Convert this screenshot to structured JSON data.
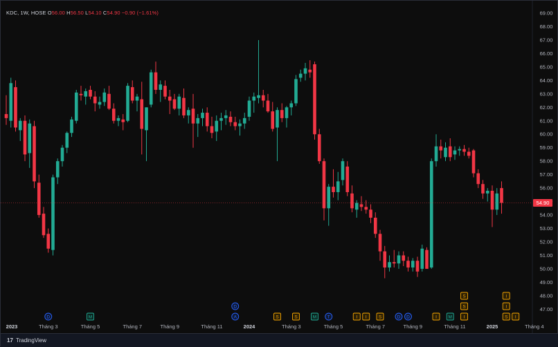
{
  "legend": {
    "symbol": "KDC, 1W, HOSE",
    "open_label": "O",
    "open": "56.00",
    "high_label": "H",
    "high": "56.50",
    "low_label": "L",
    "low": "54.10",
    "close_label": "C",
    "close": "54.90",
    "change": "−0.90 (−1.61%)"
  },
  "branding": {
    "logo": "17",
    "text": "TradingView"
  },
  "colors": {
    "up": "#22ab94",
    "down": "#f23645",
    "background": "#0d0d0d",
    "text": "#b2b5be",
    "price_label": "#f23645"
  },
  "chart_data": {
    "type": "candlestick",
    "title": "",
    "ylim": [
      46.4,
      69.0
    ],
    "y_ticks": [
      "47.00",
      "48.00",
      "49.00",
      "50.00",
      "51.00",
      "52.00",
      "53.00",
      "54.00",
      "55.00",
      "56.00",
      "57.00",
      "58.00",
      "59.00",
      "60.00",
      "61.00",
      "62.00",
      "63.00",
      "64.00",
      "65.00",
      "66.00",
      "67.00",
      "68.00",
      "69.00"
    ],
    "x_tick_labels": [
      "2023",
      "Tháng 3",
      "Tháng 5",
      "Tháng 7",
      "Tháng 9",
      "Tháng 11",
      "2024",
      "Tháng 3",
      "Tháng 5",
      "Tháng 7",
      "Tháng 9",
      "Tháng 11",
      "2025",
      "Tháng 4"
    ],
    "last_price": "54.90",
    "grid": false,
    "candles": [
      {
        "o": 61.5,
        "h": 62.9,
        "l": 60.7,
        "c": 61.2
      },
      {
        "o": 61.0,
        "h": 64.2,
        "l": 60.5,
        "c": 63.8
      },
      {
        "o": 63.5,
        "h": 64.0,
        "l": 60.2,
        "c": 60.5
      },
      {
        "o": 60.3,
        "h": 61.2,
        "l": 59.5,
        "c": 61.0
      },
      {
        "o": 61.0,
        "h": 61.4,
        "l": 58.0,
        "c": 58.5
      },
      {
        "o": 58.6,
        "h": 61.1,
        "l": 57.5,
        "c": 60.8
      },
      {
        "o": 60.6,
        "h": 61.0,
        "l": 56.0,
        "c": 56.5
      },
      {
        "o": 56.4,
        "h": 57.0,
        "l": 53.8,
        "c": 54.0
      },
      {
        "o": 54.1,
        "h": 54.6,
        "l": 52.3,
        "c": 52.5
      },
      {
        "o": 52.6,
        "h": 53.0,
        "l": 51.2,
        "c": 51.5
      },
      {
        "o": 51.4,
        "h": 57.0,
        "l": 51.0,
        "c": 56.8
      },
      {
        "o": 56.8,
        "h": 58.2,
        "l": 56.3,
        "c": 58.0
      },
      {
        "o": 58.0,
        "h": 59.2,
        "l": 57.6,
        "c": 59.0
      },
      {
        "o": 59.0,
        "h": 60.2,
        "l": 58.6,
        "c": 60.1
      },
      {
        "o": 60.1,
        "h": 61.3,
        "l": 59.8,
        "c": 61.1
      },
      {
        "o": 61.0,
        "h": 63.3,
        "l": 60.8,
        "c": 63.1
      },
      {
        "o": 63.0,
        "h": 63.6,
        "l": 62.5,
        "c": 62.9
      },
      {
        "o": 62.8,
        "h": 63.4,
        "l": 62.2,
        "c": 63.2
      },
      {
        "o": 63.3,
        "h": 63.6,
        "l": 62.6,
        "c": 62.8
      },
      {
        "o": 62.8,
        "h": 63.2,
        "l": 61.7,
        "c": 62.3
      },
      {
        "o": 62.2,
        "h": 62.8,
        "l": 61.9,
        "c": 62.4
      },
      {
        "o": 62.4,
        "h": 63.4,
        "l": 62.1,
        "c": 63.1
      },
      {
        "o": 63.0,
        "h": 63.6,
        "l": 61.8,
        "c": 61.9
      },
      {
        "o": 61.9,
        "h": 62.3,
        "l": 60.8,
        "c": 61.0
      },
      {
        "o": 61.0,
        "h": 61.4,
        "l": 60.6,
        "c": 61.2
      },
      {
        "o": 61.1,
        "h": 61.5,
        "l": 60.3,
        "c": 60.9
      },
      {
        "o": 61.0,
        "h": 63.8,
        "l": 60.9,
        "c": 63.6
      },
      {
        "o": 63.5,
        "h": 64.0,
        "l": 62.3,
        "c": 62.5
      },
      {
        "o": 62.5,
        "h": 63.0,
        "l": 61.7,
        "c": 62.8
      },
      {
        "o": 62.6,
        "h": 63.9,
        "l": 58.5,
        "c": 60.4
      },
      {
        "o": 60.3,
        "h": 62.0,
        "l": 58.0,
        "c": 62.0
      },
      {
        "o": 62.2,
        "h": 64.8,
        "l": 62.0,
        "c": 64.6
      },
      {
        "o": 64.6,
        "h": 65.4,
        "l": 63.0,
        "c": 63.3
      },
      {
        "o": 63.3,
        "h": 64.0,
        "l": 62.4,
        "c": 63.7
      },
      {
        "o": 63.6,
        "h": 64.0,
        "l": 62.6,
        "c": 62.8
      },
      {
        "o": 62.8,
        "h": 63.3,
        "l": 61.5,
        "c": 62.5
      },
      {
        "o": 62.6,
        "h": 63.0,
        "l": 61.8,
        "c": 61.9
      },
      {
        "o": 61.9,
        "h": 63.0,
        "l": 61.4,
        "c": 62.8
      },
      {
        "o": 62.7,
        "h": 63.4,
        "l": 61.2,
        "c": 61.4
      },
      {
        "o": 61.4,
        "h": 62.0,
        "l": 60.8,
        "c": 61.8
      },
      {
        "o": 61.9,
        "h": 63.0,
        "l": 59.0,
        "c": 60.8
      },
      {
        "o": 60.8,
        "h": 61.5,
        "l": 59.8,
        "c": 61.2
      },
      {
        "o": 61.2,
        "h": 61.9,
        "l": 60.6,
        "c": 61.6
      },
      {
        "o": 61.6,
        "h": 62.0,
        "l": 60.2,
        "c": 60.6
      },
      {
        "o": 60.6,
        "h": 61.3,
        "l": 59.7,
        "c": 60.1
      },
      {
        "o": 60.2,
        "h": 61.4,
        "l": 59.5,
        "c": 61.0
      },
      {
        "o": 61.0,
        "h": 61.6,
        "l": 60.3,
        "c": 61.2
      },
      {
        "o": 61.2,
        "h": 61.8,
        "l": 60.7,
        "c": 61.4
      },
      {
        "o": 61.3,
        "h": 61.7,
        "l": 60.6,
        "c": 60.9
      },
      {
        "o": 60.9,
        "h": 61.3,
        "l": 60.3,
        "c": 60.6
      },
      {
        "o": 60.6,
        "h": 61.1,
        "l": 59.9,
        "c": 60.8
      },
      {
        "o": 60.8,
        "h": 61.6,
        "l": 60.4,
        "c": 61.2
      },
      {
        "o": 61.3,
        "h": 62.8,
        "l": 61.0,
        "c": 62.5
      },
      {
        "o": 62.5,
        "h": 63.1,
        "l": 61.6,
        "c": 62.8
      },
      {
        "o": 62.7,
        "h": 67.0,
        "l": 62.3,
        "c": 62.9
      },
      {
        "o": 62.9,
        "h": 63.3,
        "l": 62.0,
        "c": 62.5
      },
      {
        "o": 62.5,
        "h": 63.0,
        "l": 61.6,
        "c": 61.7
      },
      {
        "o": 61.7,
        "h": 62.4,
        "l": 60.2,
        "c": 60.4
      },
      {
        "o": 60.5,
        "h": 62.0,
        "l": 58.0,
        "c": 61.8
      },
      {
        "o": 61.8,
        "h": 62.3,
        "l": 60.9,
        "c": 61.2
      },
      {
        "o": 61.2,
        "h": 62.1,
        "l": 60.5,
        "c": 62.0
      },
      {
        "o": 62.0,
        "h": 62.5,
        "l": 61.4,
        "c": 62.3
      },
      {
        "o": 62.3,
        "h": 64.4,
        "l": 62.1,
        "c": 64.1
      },
      {
        "o": 64.2,
        "h": 64.8,
        "l": 63.9,
        "c": 64.5
      },
      {
        "o": 64.5,
        "h": 65.3,
        "l": 64.0,
        "c": 64.9
      },
      {
        "o": 64.8,
        "h": 65.5,
        "l": 64.2,
        "c": 64.6
      },
      {
        "o": 65.2,
        "h": 65.4,
        "l": 59.6,
        "c": 60.0
      },
      {
        "o": 60.0,
        "h": 60.4,
        "l": 57.8,
        "c": 58.0
      },
      {
        "o": 58.0,
        "h": 58.2,
        "l": 53.6,
        "c": 54.5
      },
      {
        "o": 54.5,
        "h": 56.3,
        "l": 53.2,
        "c": 56.1
      },
      {
        "o": 56.1,
        "h": 57.4,
        "l": 55.3,
        "c": 55.7
      },
      {
        "o": 55.7,
        "h": 57.2,
        "l": 55.1,
        "c": 56.5
      },
      {
        "o": 56.6,
        "h": 58.2,
        "l": 56.2,
        "c": 58.0
      },
      {
        "o": 57.6,
        "h": 58.0,
        "l": 55.4,
        "c": 55.7
      },
      {
        "o": 55.6,
        "h": 56.2,
        "l": 54.2,
        "c": 54.5
      },
      {
        "o": 54.4,
        "h": 55.1,
        "l": 53.8,
        "c": 54.9
      },
      {
        "o": 54.8,
        "h": 55.4,
        "l": 54.3,
        "c": 54.6
      },
      {
        "o": 54.6,
        "h": 55.1,
        "l": 54.1,
        "c": 54.4
      },
      {
        "o": 54.4,
        "h": 54.8,
        "l": 53.4,
        "c": 53.8
      },
      {
        "o": 53.8,
        "h": 54.2,
        "l": 52.3,
        "c": 52.6
      },
      {
        "o": 52.6,
        "h": 52.9,
        "l": 50.6,
        "c": 51.3
      },
      {
        "o": 51.3,
        "h": 51.7,
        "l": 49.3,
        "c": 50.1
      },
      {
        "o": 50.1,
        "h": 51.0,
        "l": 49.8,
        "c": 50.5
      },
      {
        "o": 50.5,
        "h": 51.4,
        "l": 50.1,
        "c": 50.4
      },
      {
        "o": 50.4,
        "h": 51.3,
        "l": 50.0,
        "c": 51.0
      },
      {
        "o": 51.0,
        "h": 51.3,
        "l": 50.2,
        "c": 50.6
      },
      {
        "o": 50.6,
        "h": 50.9,
        "l": 49.8,
        "c": 50.1
      },
      {
        "o": 50.1,
        "h": 50.8,
        "l": 49.8,
        "c": 50.6
      },
      {
        "o": 50.6,
        "h": 50.9,
        "l": 49.4,
        "c": 49.8
      },
      {
        "o": 50.0,
        "h": 51.8,
        "l": 49.8,
        "c": 51.5
      },
      {
        "o": 51.4,
        "h": 51.6,
        "l": 50.0,
        "c": 50.0
      },
      {
        "o": 50.1,
        "h": 58.2,
        "l": 50.0,
        "c": 58.0
      },
      {
        "o": 58.0,
        "h": 60.0,
        "l": 57.6,
        "c": 59.1
      },
      {
        "o": 59.1,
        "h": 59.6,
        "l": 58.2,
        "c": 58.8
      },
      {
        "o": 58.3,
        "h": 59.4,
        "l": 58.0,
        "c": 59.0
      },
      {
        "o": 59.1,
        "h": 59.7,
        "l": 58.0,
        "c": 58.3
      },
      {
        "o": 58.5,
        "h": 59.1,
        "l": 58.1,
        "c": 58.8
      },
      {
        "o": 58.8,
        "h": 59.1,
        "l": 58.4,
        "c": 58.9
      },
      {
        "o": 58.9,
        "h": 59.2,
        "l": 58.4,
        "c": 58.7
      },
      {
        "o": 58.7,
        "h": 59.0,
        "l": 58.2,
        "c": 58.4
      },
      {
        "o": 58.8,
        "h": 58.9,
        "l": 56.8,
        "c": 57.1
      },
      {
        "o": 57.1,
        "h": 57.4,
        "l": 56.0,
        "c": 56.3
      },
      {
        "o": 56.3,
        "h": 56.6,
        "l": 55.2,
        "c": 55.6
      },
      {
        "o": 55.6,
        "h": 56.0,
        "l": 55.0,
        "c": 55.8
      },
      {
        "o": 55.8,
        "h": 56.2,
        "l": 53.1,
        "c": 54.4
      },
      {
        "o": 54.4,
        "h": 56.0,
        "l": 54.0,
        "c": 55.6
      },
      {
        "o": 56.0,
        "h": 56.5,
        "l": 54.1,
        "c": 54.9
      }
    ],
    "event_markers": [
      {
        "label": "D",
        "kind": "dividend",
        "week": 9
      },
      {
        "label": "M",
        "kind": "meeting",
        "week": 18
      },
      {
        "label": "A",
        "kind": "announcement",
        "week": 49
      },
      {
        "label": "D",
        "kind": "dividend",
        "week": 49
      },
      {
        "label": "S",
        "kind": "split",
        "week": 58
      },
      {
        "label": "S",
        "kind": "split",
        "week": 62
      },
      {
        "label": "M",
        "kind": "meeting",
        "week": 66
      },
      {
        "label": "T",
        "kind": "trading",
        "week": 69
      },
      {
        "label": "I",
        "kind": "info",
        "week": 75
      },
      {
        "label": "I",
        "kind": "info",
        "week": 77
      },
      {
        "label": "S",
        "kind": "split",
        "week": 80
      },
      {
        "label": "D",
        "kind": "dividend",
        "week": 84
      },
      {
        "label": "D",
        "kind": "dividend",
        "week": 86
      },
      {
        "label": "I",
        "kind": "info",
        "week": 92
      },
      {
        "label": "M",
        "kind": "meeting",
        "week": 95
      },
      {
        "label": "I",
        "kind": "info",
        "week": 98
      },
      {
        "label": "S",
        "kind": "split",
        "week": 98
      },
      {
        "label": "S",
        "kind": "split",
        "week": 98
      },
      {
        "label": "S",
        "kind": "split",
        "week": 107
      },
      {
        "label": "I",
        "kind": "info",
        "week": 109
      },
      {
        "label": "I",
        "kind": "info",
        "week": 107
      },
      {
        "label": "I",
        "kind": "info",
        "week": 107
      }
    ]
  }
}
